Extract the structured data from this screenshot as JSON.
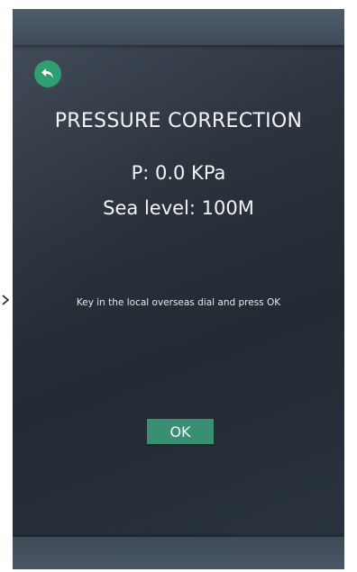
{
  "screen": {
    "title": "PRESSURE CORRECTION",
    "pressure_text": "P: 0.0 KPa",
    "sea_level_text": "Sea level: 100M",
    "instruction": "Key in the local overseas dial and press OK",
    "ok_label": "OK",
    "back_icon": "back-arrow-icon"
  },
  "colors": {
    "accent_green": "#2f9e72",
    "ok_button": "#3a8f72",
    "background": "#2a323c"
  }
}
